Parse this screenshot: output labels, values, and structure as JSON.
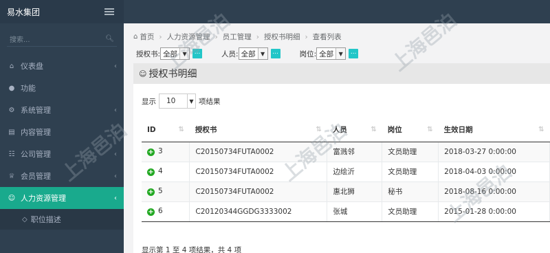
{
  "sidebar": {
    "brand": "易水集团",
    "search_placeholder": "搜索...",
    "items": [
      {
        "label": "仪表盘",
        "icon": "home-icon"
      },
      {
        "label": "功能",
        "icon": "globe-icon"
      },
      {
        "label": "系统管理",
        "icon": "gears-icon"
      },
      {
        "label": "内容管理",
        "icon": "card-icon"
      },
      {
        "label": "公司管理",
        "icon": "sitemap-icon"
      },
      {
        "label": "会员管理",
        "icon": "trophy-icon"
      },
      {
        "label": "人力资源管理",
        "icon": "users-icon",
        "active": true
      }
    ],
    "sub_item": {
      "label": "职位描述",
      "icon": "diamond-icon"
    }
  },
  "breadcrumb": [
    "首页",
    "人力资源管理",
    "员工管理",
    "授权书明细",
    "查看列表"
  ],
  "filters": [
    {
      "label": "授权书:",
      "value": "全部"
    },
    {
      "label": "人员:",
      "value": "全部"
    },
    {
      "label": "岗位:",
      "value": "全部"
    }
  ],
  "filter_button_label": "...",
  "panel": {
    "title": "授权书明细"
  },
  "length": {
    "prefix": "显示",
    "value": "10",
    "suffix": "项结果"
  },
  "table": {
    "columns": [
      "ID",
      "授权书",
      "人员",
      "岗位",
      "生效日期"
    ],
    "rows": [
      {
        "id": "3",
        "doc": "C20150734FUTA0002",
        "person": "富溅邻",
        "post": "文员助理",
        "date": "2018-03-27 0:00:00"
      },
      {
        "id": "4",
        "doc": "C20150734FUTA0002",
        "person": "边绘沂",
        "post": "文员助理",
        "date": "2018-04-03 0:00:00"
      },
      {
        "id": "5",
        "doc": "C20150734FUTA0002",
        "person": "惠北狮",
        "post": "秘书",
        "date": "2018-08-16 0:00:00"
      },
      {
        "id": "6",
        "doc": "C20120344GGDG3333002",
        "person": "张城",
        "post": "文员助理",
        "date": "2015-01-28 0:00:00"
      }
    ]
  },
  "info": "显示第 1 至 4 项结果，共 4 项",
  "watermark": "上海邑泊"
}
